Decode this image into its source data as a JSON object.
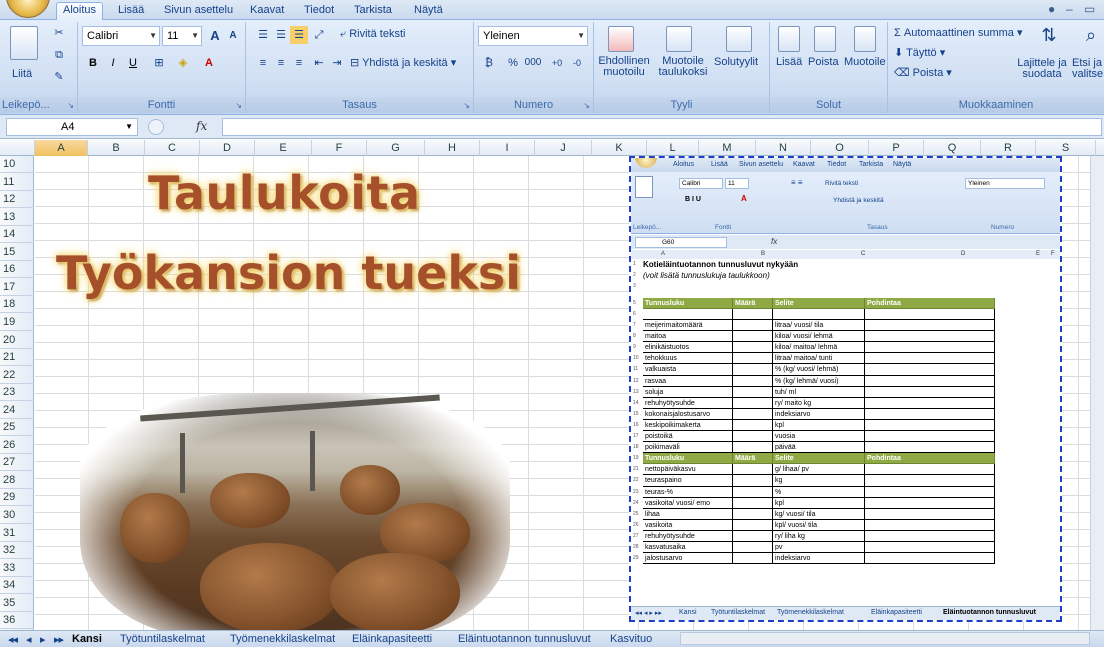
{
  "ribbon": {
    "tabs": [
      "Aloitus",
      "Lisää",
      "Sivun asettelu",
      "Kaavat",
      "Tiedot",
      "Tarkista",
      "Näytä"
    ],
    "active_tab": "Aloitus",
    "clipboard": {
      "paste": "Liitä",
      "label": "Leikepö..."
    },
    "font": {
      "name": "Calibri",
      "size": "11",
      "bold": "B",
      "italic": "I",
      "underline": "U",
      "grow": "A",
      "shrink": "A",
      "label": "Fontti"
    },
    "alignment": {
      "wrap": "Rivitä teksti",
      "merge": "Yhdistä ja keskitä",
      "label": "Tasaus"
    },
    "number": {
      "format": "Yleinen",
      "percent": "%",
      "thousands": "000",
      "label": "Numero"
    },
    "styles": {
      "conditional": "Ehdollinen muotoilu",
      "as_table": "Muotoile taulukoksi",
      "cell_styles": "Solutyylit",
      "label": "Tyyli"
    },
    "cells": {
      "insert": "Lisää",
      "delete": "Poista",
      "format": "Muotoile",
      "label": "Solut"
    },
    "editing": {
      "autosum": "Automaattinen summa",
      "fill": "Täyttö",
      "clear": "Poista",
      "sort": "Lajittele ja suodata",
      "find": "Etsi ja valitse",
      "label": "Muokkaaminen"
    }
  },
  "formula_bar": {
    "name_box": "A4",
    "fx": "fx",
    "value": ""
  },
  "columns": [
    "A",
    "B",
    "C",
    "D",
    "E",
    "F",
    "G",
    "H",
    "I",
    "J",
    "K",
    "L",
    "M",
    "N",
    "O",
    "P",
    "Q",
    "R",
    "S"
  ],
  "rows": [
    "10",
    "11",
    "12",
    "13",
    "14",
    "15",
    "16",
    "17",
    "18",
    "19",
    "20",
    "21",
    "22",
    "23",
    "24",
    "25",
    "26",
    "27",
    "28",
    "29",
    "30",
    "31",
    "32",
    "33",
    "34",
    "35",
    "36"
  ],
  "titles": {
    "line1": "Taulukoita",
    "line2": "Työkansion tueksi"
  },
  "embedded": {
    "tabs": [
      "Aloitus",
      "Lisää",
      "Sivun asettelu",
      "Kaavat",
      "Tiedot",
      "Tarkista",
      "Näytä"
    ],
    "font_name": "Calibri",
    "font_size": "11",
    "wrap": "Rivitä teksti",
    "merge": "Yhdistä ja keskitä",
    "number_format": "Yleinen",
    "group_labels": [
      "Leikepö...",
      "Fontti",
      "Tasaus",
      "Numero"
    ],
    "name_box": "G60",
    "columns": [
      "A",
      "B",
      "C",
      "D",
      "E",
      "F"
    ],
    "heading": "Kotieläintuotannon tunnusluvut nykyään",
    "subheading": "(voit lisätä tunnuslukuja taulukkoon)",
    "table_headers": [
      "Tunnusluku",
      "Määrä",
      "Selite",
      "Pohdintaa"
    ],
    "table1": [
      [
        "7",
        "meijerimaitomäärä",
        "litraa/ vuosi/ tila"
      ],
      [
        "8",
        "maitoa",
        "kiloa/ vuosi/ lehmä"
      ],
      [
        "9",
        "elinikäistuotos",
        "kiloa/ maitoa/ lehmä"
      ],
      [
        "10",
        "tehokkuus",
        "litraa/ maitoa/ tunti"
      ],
      [
        "11",
        "valkuaista",
        "% (kg/ vuosi/ lehmä)"
      ],
      [
        "12",
        "rasvaa",
        "% (kg/ lehmä/ vuosi)"
      ],
      [
        "13",
        "soluja",
        "tuh/ ml"
      ],
      [
        "14",
        "rehuhyötysuhde",
        "ry/ maito kg"
      ],
      [
        "15",
        "kokonaisjalostusarvo",
        "indeksiarvo"
      ],
      [
        "16",
        "keskipoikimakerta",
        "kpl"
      ],
      [
        "17",
        "poistoikä",
        "vuosia"
      ],
      [
        "18",
        "poikimaväli",
        "päivää"
      ]
    ],
    "table2": [
      [
        "21",
        "nettopäiväkasvu",
        "g/ lihaa/ pv"
      ],
      [
        "22",
        "teuraspaino",
        "kg"
      ],
      [
        "23",
        "teuras-%",
        "%"
      ],
      [
        "24",
        "vasikoita/ vuosi/ emo",
        "kpl"
      ],
      [
        "25",
        "lihaa",
        "kg/ vuosi/ tila"
      ],
      [
        "26",
        "vasikoita",
        "kpl/ vuosi/ tila"
      ],
      [
        "27",
        "rehuhyötysuhde",
        "ry/ liha kg"
      ],
      [
        "28",
        "kasvatusaika",
        "pv"
      ],
      [
        "29",
        "jalostusarvo",
        "indeksiarvo"
      ]
    ],
    "sheet_tabs": [
      "Kansi",
      "Työtuntilaskelmat",
      "Työmenekkilaskelmat",
      "Eläinkapasiteetti",
      "Eläintuotannon tunnusluvut"
    ]
  },
  "sheet_tabs": [
    "Kansi",
    "Työtuntilaskelmat",
    "Työmenekkilaskelmat",
    "Eläinkapasiteetti",
    "Eläintuotannon tunnusluvut",
    "Kasvituo"
  ],
  "active_sheet": "Kansi"
}
